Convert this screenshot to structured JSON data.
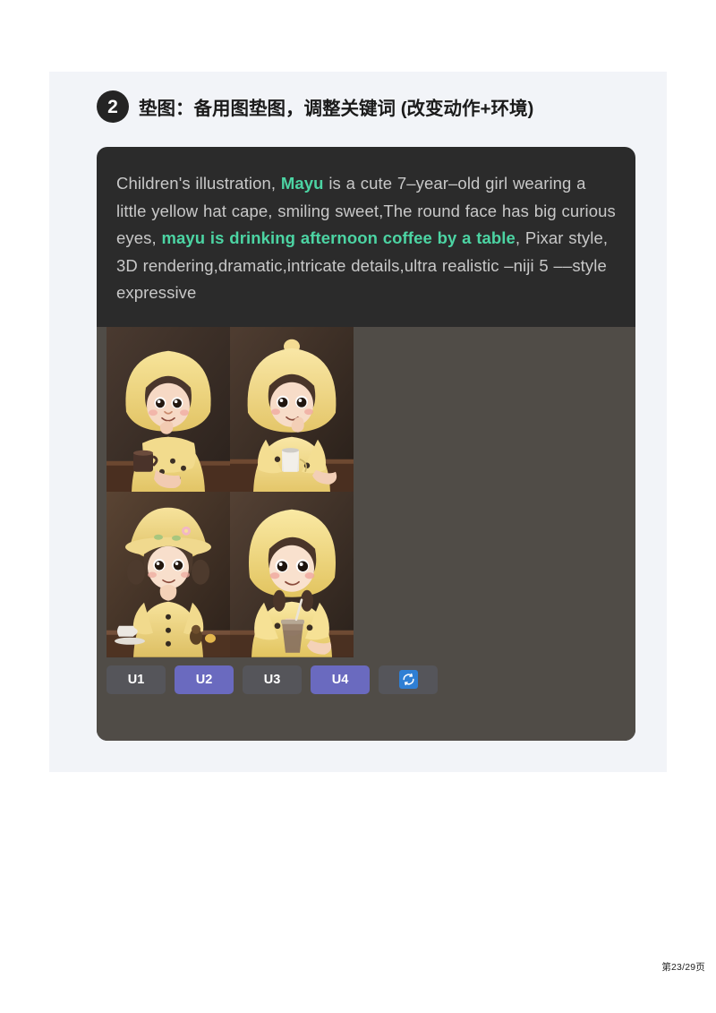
{
  "heading": {
    "step_number": "2",
    "title": "垫图：备用图垫图，调整关键词 (改变动作+环境)"
  },
  "prompt": {
    "segments": [
      {
        "text": "Children's illustration, ",
        "accent": false
      },
      {
        "text": "Mayu",
        "accent": true
      },
      {
        "text": " is a cute 7–year–old girl wearing a little yellow hat cape, smiling sweet,The round face has big curious eyes, ",
        "accent": false
      },
      {
        "text": "mayu is drinking afternoon coffee by a table",
        "accent": true
      },
      {
        "text": ", Pixar style, 3D rendering,dramatic,intricate details,ultra realistic –niji 5 ––style expressive",
        "accent": false
      }
    ],
    "full_text": "Children's illustration, Mayu is a cute 7–year–old girl wearing a little yellow hat cape, smiling sweet,The round face has big curious eyes, mayu is drinking afternoon coffee by a table, Pixar style, 3D rendering,dramatic,intricate details,ultra realistic –niji 5 ––style expressive",
    "accent_color": "#4cd4a3",
    "text_color": "#c8c8c8",
    "background_color": "#2b2b2b"
  },
  "results": {
    "background_color": "#504c47",
    "thumbnails": [
      {
        "alt": "girl in yellow rain hat resting chin on hand with dark coffee mug on table",
        "name": "result-image-1"
      },
      {
        "alt": "girl in yellow rain cape with white paper coffee cup on table",
        "name": "result-image-2"
      },
      {
        "alt": "girl in yellow bonnet hands clasped with milk jug and saucer on table",
        "name": "result-image-3"
      },
      {
        "alt": "girl in yellow hood holding iced coffee cup with straw",
        "name": "result-image-4"
      }
    ]
  },
  "toolbar": {
    "buttons": [
      {
        "label": "U1",
        "selected": false
      },
      {
        "label": "U2",
        "selected": true
      },
      {
        "label": "U3",
        "selected": false
      },
      {
        "label": "U4",
        "selected": true
      }
    ],
    "refresh_icon": "refresh-icon",
    "selected_color": "#6a6abf",
    "default_color": "#55555a",
    "refresh_chip_color": "#2f7fd4"
  },
  "footer": {
    "page_label": "第23/29页"
  }
}
